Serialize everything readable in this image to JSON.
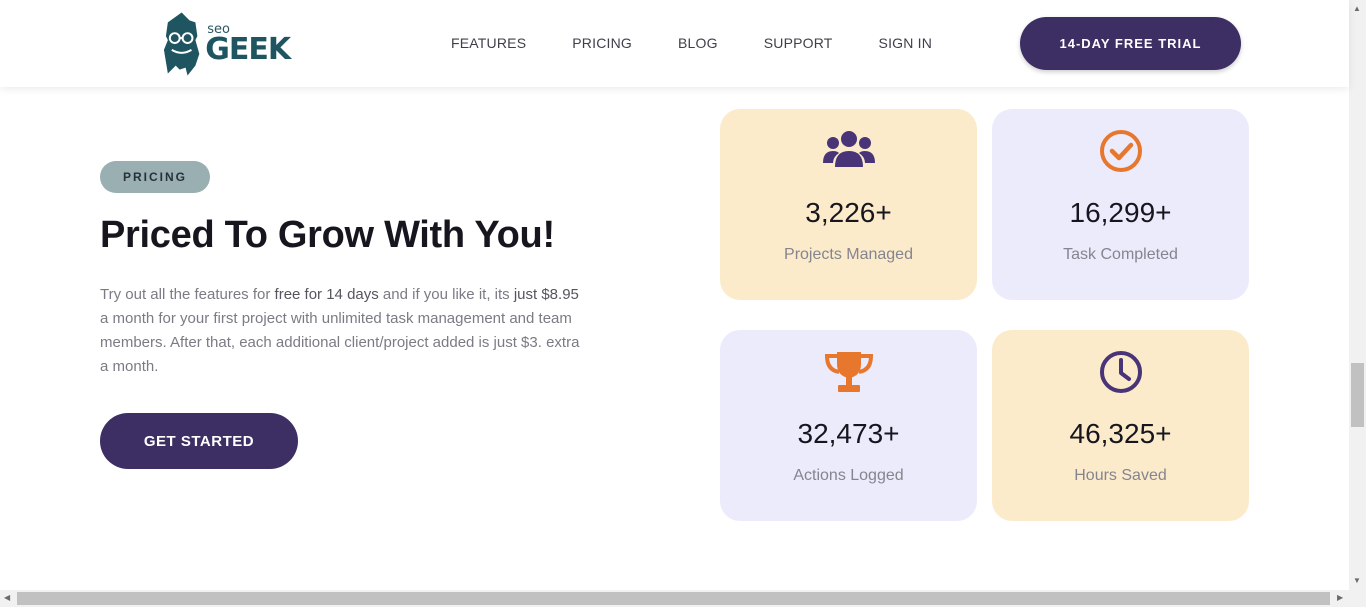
{
  "brand": {
    "small": "seo",
    "large": "GEEK",
    "color": "#1f5561"
  },
  "nav": [
    "FEATURES",
    "PRICING",
    "BLOG",
    "SUPPORT",
    "SIGN IN"
  ],
  "header": {
    "trial_label": "14-DAY FREE TRIAL"
  },
  "hero": {
    "badge": "PRICING",
    "title": "Priced To Grow With You!",
    "desc": {
      "p1": "Try out all the features for ",
      "h1": "free for 14 days",
      "p2": " and if you like it, its ",
      "h2": "just $8.95",
      "p3": " a month for your first project with unlimited task management and team members. After that, each additional client/project added is just $3. extra a month."
    },
    "cta_label": "GET STARTED"
  },
  "stats": [
    {
      "value": "3,226+",
      "label": "Projects Managed",
      "icon": "users-icon",
      "bg": "#fbebcb"
    },
    {
      "value": "16,299+",
      "label": "Task Completed",
      "icon": "check-circle-icon",
      "bg": "#ebebfc"
    },
    {
      "value": "32,473+",
      "label": "Actions Logged",
      "icon": "trophy-icon",
      "bg": "#ebebfc"
    },
    {
      "value": "46,325+",
      "label": "Hours Saved",
      "icon": "clock-icon",
      "bg": "#fbebcb"
    }
  ],
  "colors": {
    "primary": "#3d2e64",
    "accent_orange": "#e8772e",
    "icon_purple": "#4a3478"
  }
}
